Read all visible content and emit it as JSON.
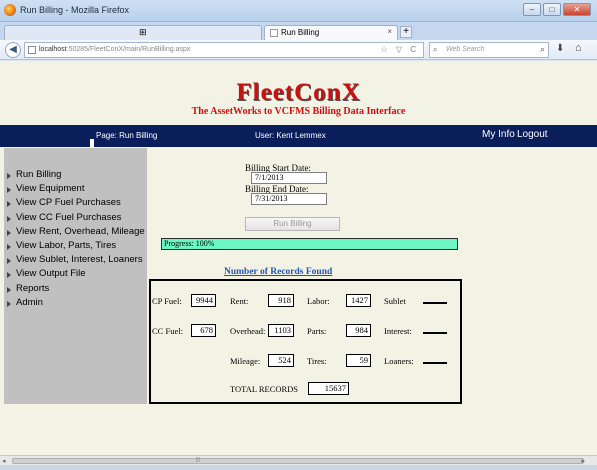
{
  "window": {
    "title": "Run Billing - Mozilla Firefox",
    "controls": {
      "minimize": "–",
      "maximize": "□",
      "close": "✕"
    }
  },
  "tabs": [
    {
      "label": "",
      "glyph": "⊞"
    },
    {
      "label": "Run Billing",
      "close": "×"
    }
  ],
  "newtab_label": "+",
  "address_bar": {
    "url_host": "localhost",
    "url_rest": ":50285/FleetConX/main/RunBilling.aspx",
    "icons": "☆ ▽ C"
  },
  "search": {
    "placeholder": "Web Search",
    "engine_glyph": "⌕",
    "go_glyph": "🔍"
  },
  "page": {
    "brand": "FleetConX",
    "tagline": "The AssetWorks to VCFMS Billing Data Interface",
    "header": {
      "page_label": "Page: Run Billing",
      "user_label": "User: Kent Lemmex",
      "my_info": "My Info",
      "logout": "Logout"
    },
    "menu": [
      "Run Billing",
      "View Equipment",
      "View CP Fuel Purchases",
      "View CC Fuel Purchases",
      "View Rent, Overhead, Mileage",
      "View Labor, Parts, Tires",
      "View Sublet, Interest, Loaners",
      "View Output File",
      "Reports",
      "Admin"
    ],
    "billing": {
      "start_label": "Billing Start Date:",
      "start_value": "7/1/2013",
      "end_label": "Billing End Date:",
      "end_value": "7/31/2013",
      "run_button": "Run Billing"
    },
    "progress": {
      "text": "Progress: 100%",
      "fraction": 1.0
    },
    "records_title": "Number of Records Found",
    "records": {
      "cp_fuel_label": "CP Fuel:",
      "cp_fuel": "9944",
      "cc_fuel_label": "CC Fuel:",
      "cc_fuel": "678",
      "rent_label": "Rent:",
      "rent": "918",
      "overhead_label": "Overhead:",
      "overhead": "1103",
      "mileage_label": "Mileage:",
      "mileage": "524",
      "labor_label": "Labor:",
      "labor": "1427",
      "parts_label": "Parts:",
      "parts": "984",
      "tires_label": "Tires:",
      "tires": "59",
      "sublet_label": "Sublet",
      "interest_label": "Interest:",
      "loaners_label": "Loaners:",
      "total_label": "TOTAL RECORDS",
      "total": "15637"
    }
  },
  "colors": {
    "brand": "#cc1010",
    "header_bg": "#0b1e5c",
    "sidebar_bg": "#c0c0c0",
    "page_bg": "#f3f3e5",
    "progress_fill": "#6af7c3",
    "link": "#2753b0"
  }
}
